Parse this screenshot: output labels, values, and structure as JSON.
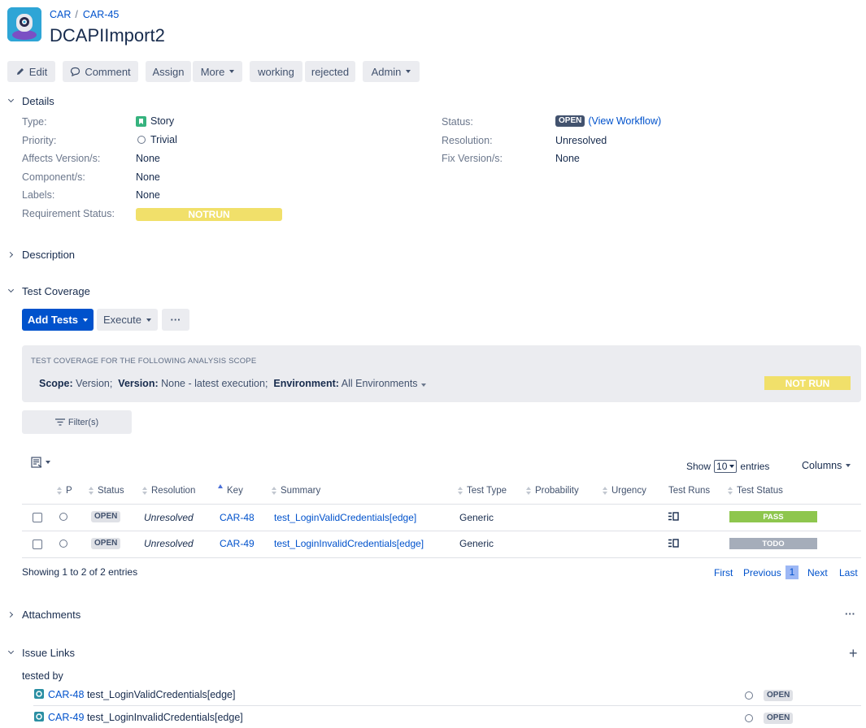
{
  "breadcrumb": {
    "project": "CAR",
    "issue": "CAR-45"
  },
  "issue": {
    "title": "DCAPIImport2"
  },
  "toolbar": {
    "edit": "Edit",
    "comment": "Comment",
    "assign": "Assign",
    "more": "More",
    "working": "working",
    "rejected": "rejected",
    "admin": "Admin"
  },
  "details": {
    "header": "Details",
    "type_label": "Type:",
    "type_value": "Story",
    "priority_label": "Priority:",
    "priority_value": "Trivial",
    "affects_label": "Affects Version/s:",
    "affects_value": "None",
    "component_label": "Component/s:",
    "component_value": "None",
    "labels_label": "Labels:",
    "labels_value": "None",
    "req_status_label": "Requirement Status:",
    "req_status_value": "NOTRUN",
    "status_label": "Status:",
    "status_value": "OPEN",
    "view_workflow": "(View Workflow)",
    "resolution_label": "Resolution:",
    "resolution_value": "Unresolved",
    "fix_label": "Fix Version/s:",
    "fix_value": "None"
  },
  "description": {
    "header": "Description"
  },
  "test_coverage": {
    "header": "Test Coverage",
    "add_tests": "Add Tests",
    "execute": "Execute",
    "more": "···",
    "scope_title": "TEST COVERAGE FOR THE FOLLOWING ANALYSIS SCOPE",
    "scope_label": "Scope:",
    "scope_value": "Version;",
    "version_label": "Version:",
    "version_value": "None - latest execution;",
    "env_label": "Environment:",
    "env_value": "All Environments",
    "overall_status": "NOT RUN",
    "filter": "Filter(s)",
    "show": "Show",
    "entries_value": "10",
    "entries": "entries",
    "columns": "Columns",
    "headers": {
      "p": "P",
      "status": "Status",
      "resolution": "Resolution",
      "key": "Key",
      "summary": "Summary",
      "test_type": "Test Type",
      "probability": "Probability",
      "urgency": "Urgency",
      "test_runs": "Test Runs",
      "test_status": "Test Status"
    },
    "rows": [
      {
        "status": "OPEN",
        "resolution": "Unresolved",
        "key": "CAR-48",
        "summary": "test_LoginValidCredentials[edge]",
        "test_type": "Generic",
        "test_status": "PASS",
        "test_status_color": "#8ec64e"
      },
      {
        "status": "OPEN",
        "resolution": "Unresolved",
        "key": "CAR-49",
        "summary": "test_LoginInvalidCredentials[edge]",
        "test_type": "Generic",
        "test_status": "TODO",
        "test_status_color": "#a5adba"
      }
    ],
    "showing": "Showing 1 to 2 of 2 entries",
    "pagination": {
      "first": "First",
      "previous": "Previous",
      "page": "1",
      "next": "Next",
      "last": "Last"
    }
  },
  "attachments": {
    "header": "Attachments",
    "more": "···"
  },
  "issue_links": {
    "header": "Issue Links",
    "add": "+",
    "relation": "tested by",
    "links": [
      {
        "key": "CAR-48",
        "summary": "test_LoginValidCredentials[edge]",
        "status": "OPEN"
      },
      {
        "key": "CAR-49",
        "summary": "test_LoginInvalidCredentials[edge]",
        "status": "OPEN"
      }
    ]
  },
  "colors": {
    "accent": "#0052cc",
    "notrun": "#f1e06a",
    "pass": "#8ec64e",
    "todo": "#a5adba"
  }
}
